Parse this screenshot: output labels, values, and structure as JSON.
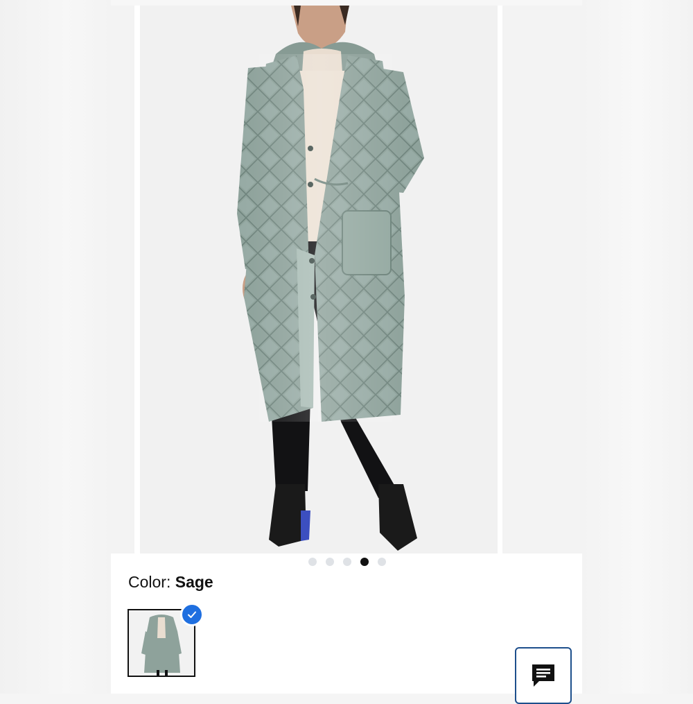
{
  "product": {
    "color_label": "Color:",
    "color_value": "Sage"
  },
  "carousel": {
    "slide_count": 5,
    "active_index": 3
  },
  "icons": {
    "selected_badge": "checkmark-icon",
    "chat": "chat-bubble-icon"
  },
  "colors": {
    "coat": "#8fa39c",
    "active_dot": "#111111",
    "inactive_dot": "#dfe2e6",
    "badge_blue": "#1f6fe0",
    "chat_border": "#1d4f8c"
  }
}
